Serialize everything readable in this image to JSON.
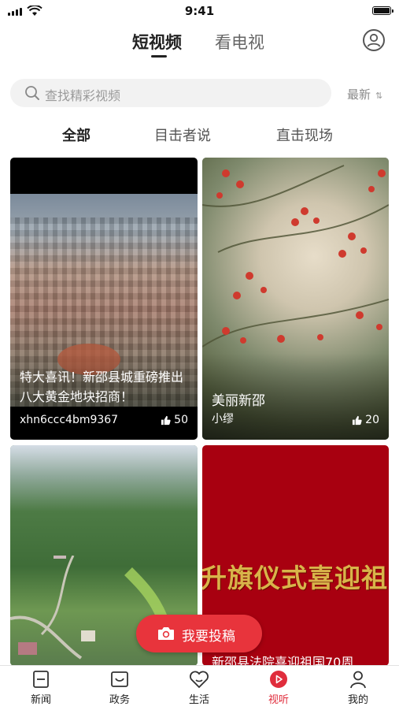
{
  "status_bar": {
    "time": "9:41"
  },
  "top_tabs": [
    {
      "label": "短视频",
      "active": true
    },
    {
      "label": "看电视",
      "active": false
    }
  ],
  "search": {
    "placeholder": "查找精彩视频"
  },
  "sort": {
    "label": "最新"
  },
  "categories": [
    {
      "label": "全部",
      "active": true
    },
    {
      "label": "目击者说",
      "active": false
    },
    {
      "label": "直击现场",
      "active": false
    }
  ],
  "videos": [
    {
      "title": "特大喜讯！新邵县城重磅推出八大黄金地块招商！",
      "author": "xhn6ccc4bm9367",
      "likes": "50"
    },
    {
      "title": "美丽新邵",
      "author": "小缪",
      "likes": "20"
    },
    {
      "title": "",
      "author": "",
      "likes": ""
    },
    {
      "title": "新邵县法院喜迎祖国70周",
      "banner_text": "升旗仪式喜迎祖国",
      "author": "",
      "likes": ""
    }
  ],
  "fab": {
    "label": "我要投稿"
  },
  "tab_bar": [
    {
      "label": "新闻",
      "icon": "news-icon",
      "active": false
    },
    {
      "label": "政务",
      "icon": "government-icon",
      "active": false
    },
    {
      "label": "生活",
      "icon": "life-icon",
      "active": false
    },
    {
      "label": "视听",
      "icon": "video-play-icon",
      "active": true
    },
    {
      "label": "我的",
      "icon": "profile-icon",
      "active": false
    }
  ],
  "colors": {
    "accent": "#e02d3c",
    "fab": "#e8343c",
    "red_card": "#a80010",
    "banner_gold": "#d8b44a"
  }
}
